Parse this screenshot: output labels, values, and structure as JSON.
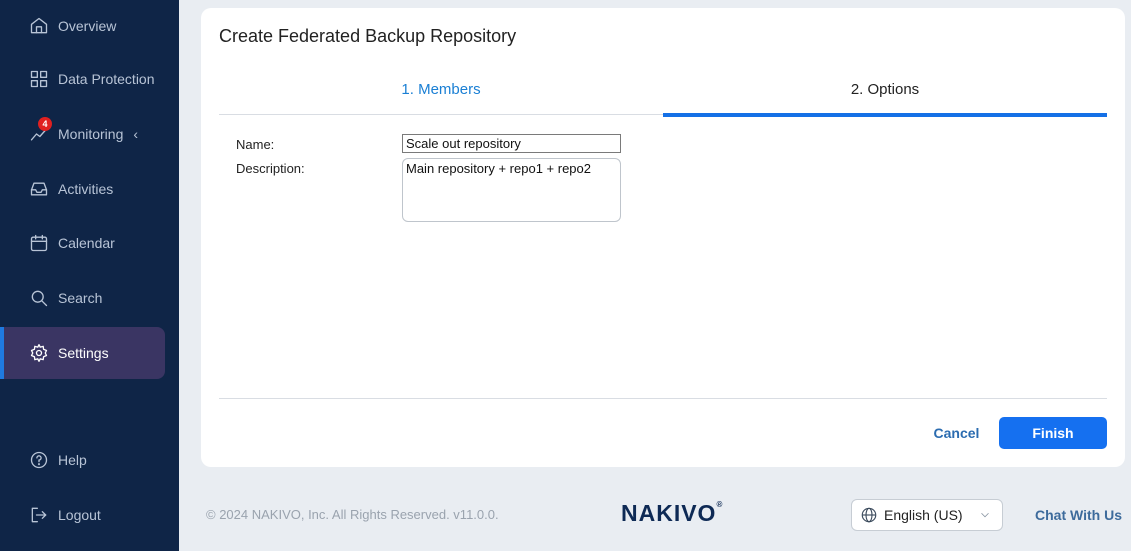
{
  "sidebar": {
    "items": [
      {
        "label": "Overview"
      },
      {
        "label": "Data Protection"
      },
      {
        "label": "Monitoring",
        "badge": "4"
      },
      {
        "label": "Activities"
      },
      {
        "label": "Calendar"
      },
      {
        "label": "Search"
      },
      {
        "label": "Settings",
        "active": true
      },
      {
        "label": "Help"
      },
      {
        "label": "Logout"
      }
    ]
  },
  "dialog": {
    "title": "Create Federated Backup Repository",
    "tabs": [
      {
        "label": "1. Members"
      },
      {
        "label": "2. Options",
        "active": true
      }
    ],
    "name_label": "Name:",
    "name_value": "Scale out repository",
    "description_label": "Description:",
    "description_value": "Main repository + repo1 + repo2",
    "cancel_label": "Cancel",
    "finish_label": "Finish"
  },
  "footer": {
    "copyright": "© 2024 NAKIVO, Inc. All Rights Reserved. v11.0.0.",
    "logo_text": "NAKIVO",
    "logo_mark": "®",
    "language": "English (US)",
    "chat_label": "Chat With Us"
  },
  "colors": {
    "sidebar_bg": "#0f2547",
    "accent": "#1570f0",
    "active_item_bg": "#3a3563"
  }
}
